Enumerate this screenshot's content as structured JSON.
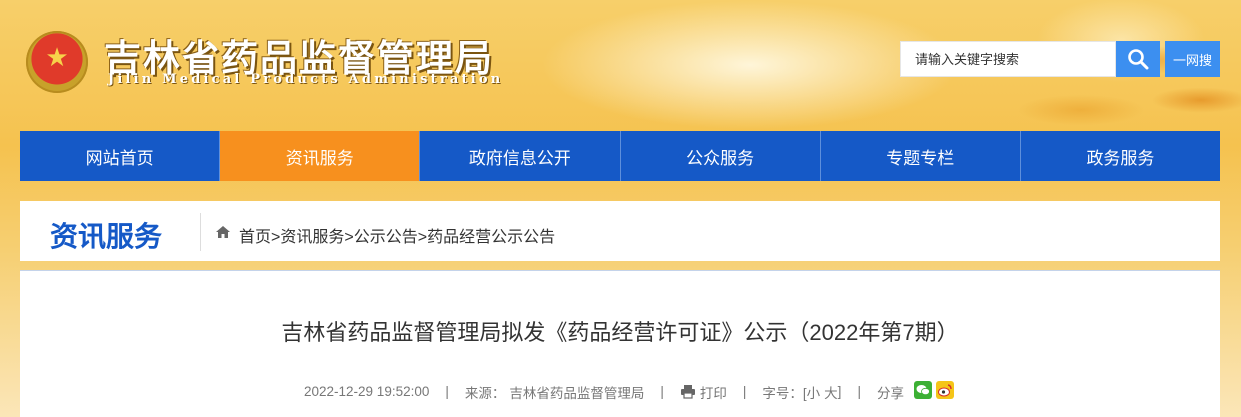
{
  "header": {
    "title": "吉林省药品监督管理局",
    "subtitle": "Jilin Medical Products Administration",
    "search_placeholder": "请输入关键字搜索",
    "yiwang_label": "一网搜"
  },
  "nav": {
    "items": [
      {
        "label": "网站首页",
        "active": false
      },
      {
        "label": "资讯服务",
        "active": true
      },
      {
        "label": "政府信息公开",
        "active": false
      },
      {
        "label": "公众服务",
        "active": false
      },
      {
        "label": "专题专栏",
        "active": false
      },
      {
        "label": "政务服务",
        "active": false
      }
    ]
  },
  "breadcrumb": {
    "section_title": "资讯服务",
    "home": "首页",
    "sep": ">",
    "level1": "资讯服务",
    "level2": "公示公告",
    "level3": "药品经营公示公告"
  },
  "article": {
    "title": "吉林省药品监督管理局拟发《药品经营许可证》公示（2022年第7期）",
    "datetime": "2022-12-29 19:52:00",
    "source_label": "来源：",
    "source": "吉林省药品监督管理局",
    "print_label": "打印",
    "fontsize_label": "字号：[",
    "font_small": "小",
    "font_large": "大",
    "fontsize_close": "]",
    "share_label": "分享"
  },
  "colors": {
    "nav_blue": "#1559c7",
    "nav_active": "#f7901e",
    "search_blue": "#3c8ff0"
  }
}
